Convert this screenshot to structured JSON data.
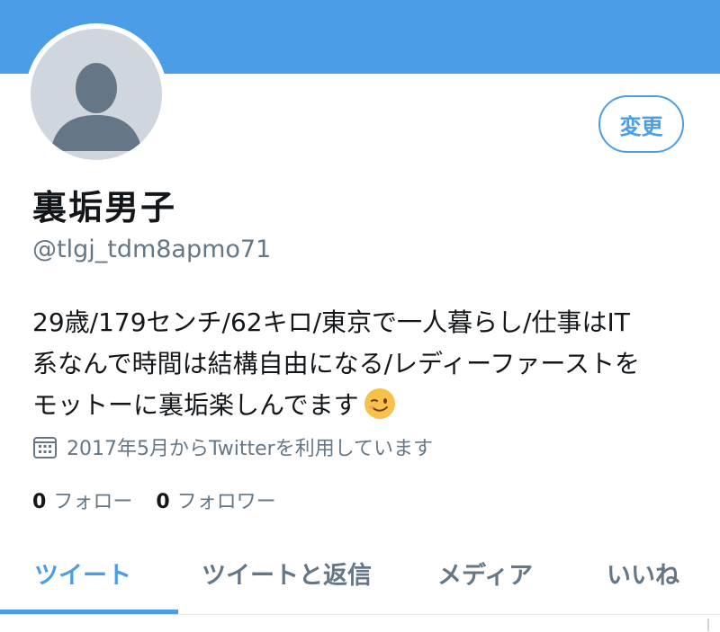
{
  "colors": {
    "accent": "#4a9de6",
    "banner": "#4a9de6",
    "text_primary": "#14171a",
    "text_secondary": "#657786"
  },
  "profile": {
    "avatar_icon": "default-avatar-icon",
    "edit_button_label": "変更",
    "display_name": "裏垢男子",
    "handle": "@tlgj_tdm8apmo71",
    "bio_lines": [
      "29歳/179センチ/62キロ/東京で一人暮らし/仕事はIT",
      "系なんで時間は結構自由になる/レディーファーストを",
      "モットーに裏垢楽しんでます"
    ],
    "bio_emoji": "winking-face-emoji",
    "joined_icon": "calendar-icon",
    "joined_text": "2017年5月からTwitterを利用しています",
    "following_count": "0",
    "following_label": "フォロー",
    "followers_count": "0",
    "followers_label": "フォロワー"
  },
  "tabs": [
    {
      "label": "ツイート",
      "active": true
    },
    {
      "label": "ツイートと返信",
      "active": false
    },
    {
      "label": "メディア",
      "active": false
    },
    {
      "label": "いいね",
      "active": false
    }
  ]
}
